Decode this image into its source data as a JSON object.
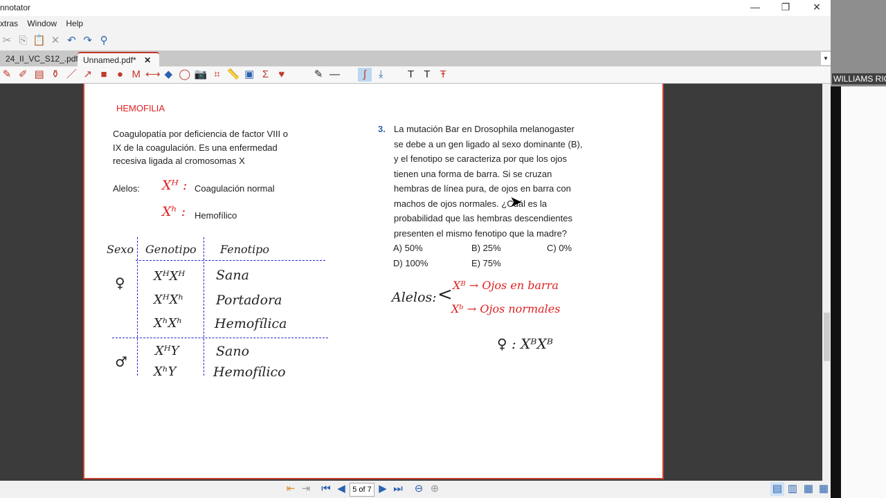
{
  "window": {
    "title": "nnotator",
    "minimize": "—",
    "restore": "❐",
    "close": "✕"
  },
  "menu": [
    "xtras",
    "Window",
    "Help"
  ],
  "tabs": [
    {
      "label": "24_II_VC_S12_.pdf"
    },
    {
      "label": "Unnamed.pdf*",
      "close": "✕"
    }
  ],
  "camera": {
    "name": "WILLIAMS RIC"
  },
  "colors": {
    "accent": "#c0392b",
    "workspace": "#3b3b3b",
    "ink_red": "#e02020"
  },
  "document": {
    "heading": "HEMOFILIA",
    "intro": [
      "Coagulopatía por deficiencia de factor VIII o",
      "IX de la coagulación. Es una enfermedad",
      "recesiva ligada al cromosomas X"
    ],
    "alleles_label": "Alelos:",
    "allele1_symbol": "Xᴴ :",
    "allele1_text": "Coagulación normal",
    "allele2_symbol": "Xʰ :",
    "allele2_text": "Hemofílico",
    "table": {
      "headers": [
        "Sexo",
        "Genotipo",
        "Fenotipo"
      ],
      "female_symbol": "♀",
      "male_symbol": "♂",
      "rows": [
        [
          "XᴴXᴴ",
          "Sana"
        ],
        [
          "XᴴXʰ",
          "Portadora"
        ],
        [
          "XʰXʰ",
          "Hemofílica"
        ],
        [
          "XᴴY",
          "Sano"
        ],
        [
          "XʰY",
          "Hemofílico"
        ]
      ]
    },
    "question": {
      "number": "3.",
      "lines": [
        "La mutación Bar en Drosophila melanogaster",
        "se debe a un gen ligado al sexo dominante (B),",
        "y el fenotipo se caracteriza por que los ojos",
        "tienen una forma de barra. Si se cruzan",
        "hembras de línea pura, de ojos en barra con",
        "machos de ojos normales. ¿Cuál es la",
        "probabilidad que las hembras descendientes",
        "presenten el mismo fenotipo que la madre?"
      ],
      "options": [
        "A)  50%",
        "B)  25%",
        "C)  0%",
        "D)  100%",
        "E)  75%"
      ]
    },
    "notes": {
      "alleles_label": "Alelos:",
      "a1": "Xᴮ → Ojos en barra",
      "a2": "Xᵇ → Ojos normales",
      "cross": "♀ : XᴮXᴮ"
    }
  },
  "status": {
    "page": "5 of 7"
  }
}
